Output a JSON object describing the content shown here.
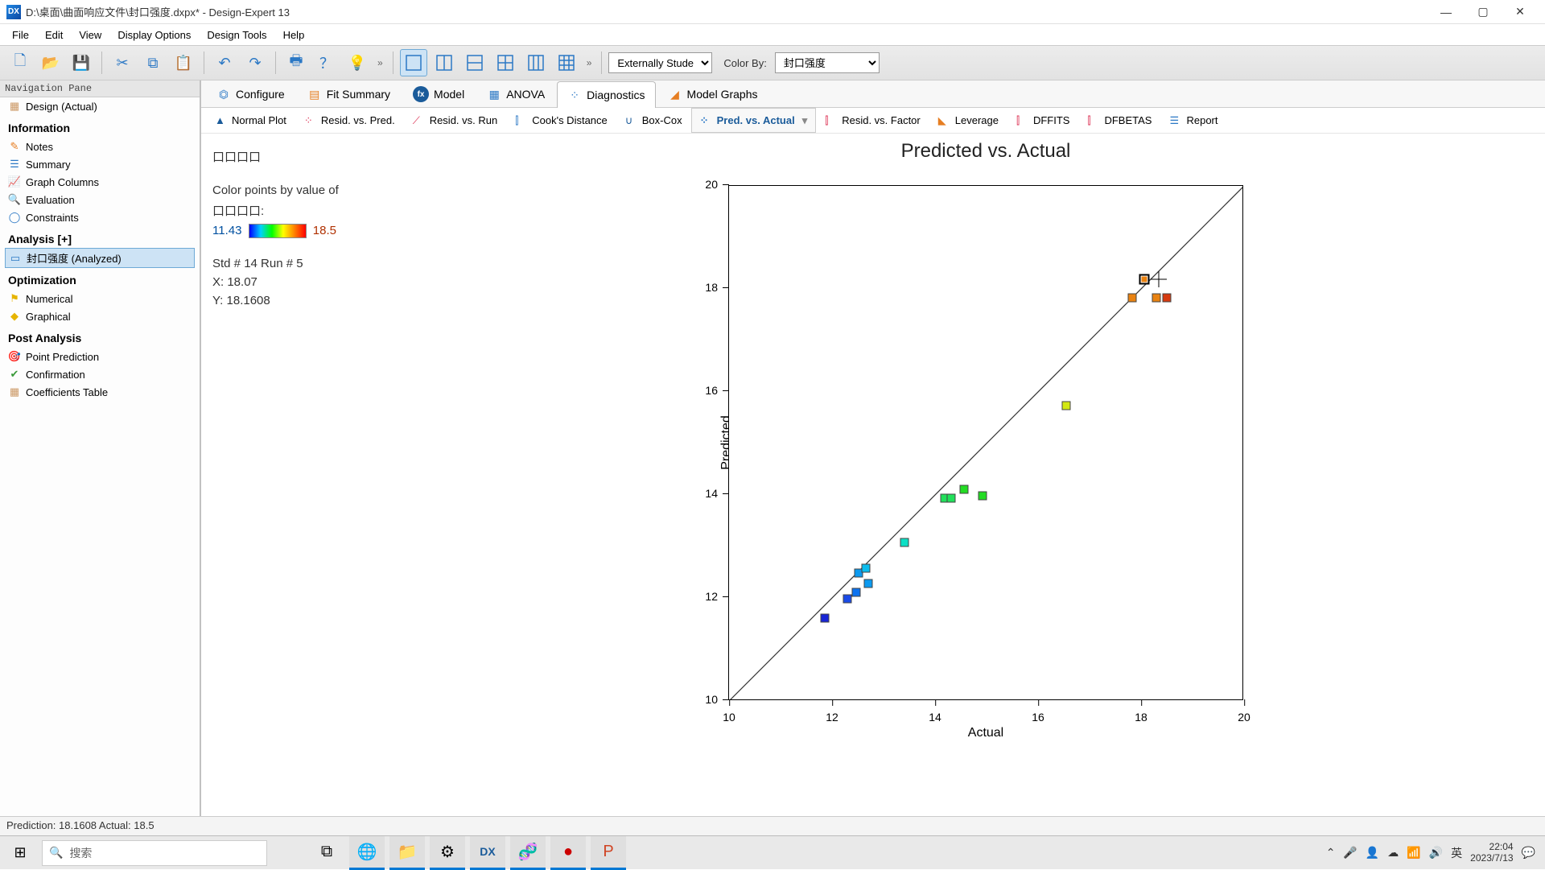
{
  "window": {
    "app_icon_text": "DX",
    "title": "D:\\桌面\\曲面响应文件\\封口强度.dxpx* - Design-Expert 13"
  },
  "menubar": [
    "File",
    "Edit",
    "View",
    "Display Options",
    "Design Tools",
    "Help"
  ],
  "toolbar": {
    "graph_label": "Externally Stude",
    "color_by_label": "Color By:",
    "color_by_value": "封口强度"
  },
  "nav": {
    "pane_title": "Navigation Pane",
    "design_item": "Design (Actual)",
    "sections": {
      "information": {
        "title": "Information",
        "items": [
          "Notes",
          "Summary",
          "Graph Columns",
          "Evaluation",
          "Constraints"
        ]
      },
      "analysis": {
        "title": "Analysis [+]",
        "items": [
          "封口强度 (Analyzed)"
        ]
      },
      "optimization": {
        "title": "Optimization",
        "items": [
          "Numerical",
          "Graphical"
        ]
      },
      "post": {
        "title": "Post Analysis",
        "items": [
          "Point Prediction",
          "Confirmation",
          "Coefficients Table"
        ]
      }
    }
  },
  "tabs": {
    "main": [
      "Configure",
      "Fit Summary",
      "Model",
      "ANOVA",
      "Diagnostics",
      "Model Graphs"
    ],
    "main_active": "Diagnostics",
    "sub": [
      "Normal Plot",
      "Resid. vs. Pred.",
      "Resid. vs. Run",
      "Cook's Distance",
      "Box-Cox",
      "Pred. vs. Actual",
      "Resid. vs. Factor",
      "Leverage",
      "DFFITS",
      "DFBETAS",
      "Report"
    ],
    "sub_active": "Pred. vs. Actual"
  },
  "side_info": {
    "block1": "口口口口",
    "line1": "Color points by value of",
    "line2": "口口口口:",
    "min": "11.43",
    "max": "18.5",
    "std_run": "Std # 14 Run # 5",
    "x": "X: 18.07",
    "y": "Y: 18.1608"
  },
  "chart_data": {
    "type": "scatter",
    "title": "Predicted vs. Actual",
    "xlabel": "Actual",
    "ylabel": "Predicted",
    "xlim": [
      10,
      20
    ],
    "ylim": [
      10,
      20
    ],
    "x_ticks": [
      10,
      12,
      14,
      16,
      18,
      20
    ],
    "y_ticks": [
      10,
      12,
      14,
      16,
      18,
      20
    ],
    "reference_line": {
      "x1": 10,
      "y1": 10,
      "x2": 20,
      "y2": 20
    },
    "color_scale": {
      "min": 11.43,
      "max": 18.5,
      "gradient": [
        "#0000ff",
        "#00d0ff",
        "#00ff00",
        "#ffff00",
        "#ff8000",
        "#ff0000"
      ]
    },
    "series": [
      {
        "name": "points",
        "values": [
          {
            "x": 11.86,
            "y": 11.58,
            "color": "#1825d6"
          },
          {
            "x": 12.3,
            "y": 11.95,
            "color": "#1a4be8"
          },
          {
            "x": 12.47,
            "y": 12.08,
            "color": "#0c72f0"
          },
          {
            "x": 12.7,
            "y": 12.25,
            "color": "#0c9af0"
          },
          {
            "x": 12.52,
            "y": 12.45,
            "color": "#0c9af0"
          },
          {
            "x": 12.66,
            "y": 12.55,
            "color": "#0cbdee"
          },
          {
            "x": 13.4,
            "y": 13.05,
            "color": "#0ce0c5"
          },
          {
            "x": 14.18,
            "y": 13.9,
            "color": "#21e05a"
          },
          {
            "x": 14.32,
            "y": 13.9,
            "color": "#21e05a"
          },
          {
            "x": 14.56,
            "y": 14.08,
            "color": "#24dc24"
          },
          {
            "x": 14.92,
            "y": 13.95,
            "color": "#24dc24"
          },
          {
            "x": 16.55,
            "y": 15.7,
            "color": "#d3e813"
          },
          {
            "x": 17.83,
            "y": 17.8,
            "color": "#e98211"
          },
          {
            "x": 18.07,
            "y": 18.1608,
            "color": "#e98211",
            "selected": true
          },
          {
            "x": 18.3,
            "y": 17.8,
            "color": "#e98211"
          },
          {
            "x": 18.5,
            "y": 17.8,
            "color": "#d63a10"
          }
        ]
      }
    ]
  },
  "status": "Prediction: 18.1608  Actual: 18.5",
  "taskbar": {
    "search_placeholder": "搜索",
    "ime": "英",
    "time": "22:04",
    "date": "2023/7/13"
  }
}
